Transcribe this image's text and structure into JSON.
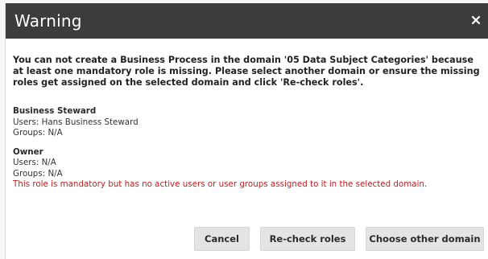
{
  "dialog": {
    "title": "Warning",
    "close_icon": "close-icon",
    "message": "You can not create a Business Process in the domain '05 Data Subject Categories' because at least one mandatory role is missing. Please select another domain or ensure the missing roles get assigned on the selected domain and click 'Re-check roles'.",
    "roles": [
      {
        "name": "Business Steward",
        "users": "Users: Hans Business Steward",
        "groups": "Groups: N/A"
      },
      {
        "name": "Owner",
        "users": "Users: N/A",
        "groups": "Groups: N/A",
        "error": "This role is mandatory but has no active users or user groups assigned to it in the selected domain."
      }
    ],
    "buttons": {
      "cancel": "Cancel",
      "recheck": "Re-check roles",
      "choose_domain": "Choose other domain"
    }
  },
  "colors": {
    "titlebar": "#3c3c3c",
    "error": "#c0201e",
    "button_bg": "#e4e4e4"
  }
}
